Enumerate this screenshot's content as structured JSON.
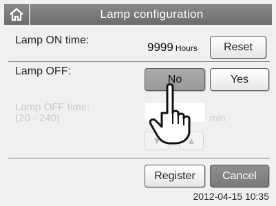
{
  "header": {
    "title": "Lamp configuration",
    "home_icon": "home-icon"
  },
  "lamp_on": {
    "label": "Lamp ON time:",
    "value": "9999",
    "unit": "Hours",
    "reset_label": "Reset"
  },
  "lamp_off": {
    "label": "Lamp OFF:",
    "no_label": "No",
    "yes_label": "Yes",
    "selected": "No"
  },
  "lamp_off_time": {
    "label_line1": "Lamp OFF time:",
    "label_line2": "(20 - 240)",
    "value": "",
    "unit": "min",
    "down_icon": "triangle-down-icon",
    "up_icon": "triangle-up-icon"
  },
  "footer": {
    "register_label": "Register",
    "cancel_label": "Cancel",
    "timestamp": "2012-04-15 10:35"
  },
  "overlay": {
    "icon": "pointing-hand-icon"
  }
}
